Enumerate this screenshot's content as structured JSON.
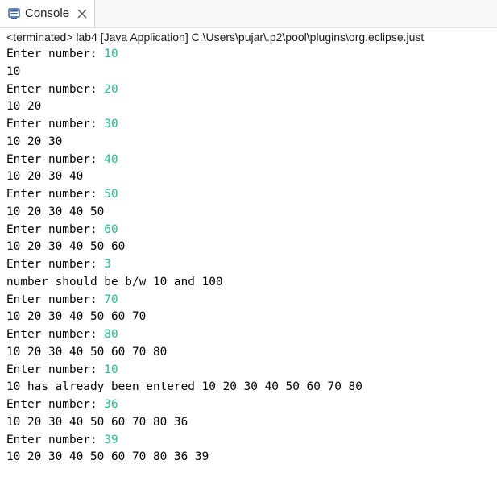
{
  "tab": {
    "label": "Console",
    "icon": "console-icon",
    "close_icon": "close-icon"
  },
  "status": {
    "text": "<terminated> lab4 [Java Application] C:\\Users\\pujar\\.p2\\pool\\plugins\\org.eclipse.just"
  },
  "colors": {
    "input": "#21c08b",
    "output": "#000000"
  },
  "output": {
    "lines": [
      {
        "text": "Enter number: ",
        "input": "10"
      },
      {
        "text": "10",
        "input": ""
      },
      {
        "text": "Enter number: ",
        "input": "20"
      },
      {
        "text": "10 20",
        "input": ""
      },
      {
        "text": "Enter number: ",
        "input": "30"
      },
      {
        "text": "10 20 30",
        "input": ""
      },
      {
        "text": "Enter number: ",
        "input": "40"
      },
      {
        "text": "10 20 30 40",
        "input": ""
      },
      {
        "text": "Enter number: ",
        "input": "50"
      },
      {
        "text": "10 20 30 40 50",
        "input": ""
      },
      {
        "text": "Enter number: ",
        "input": "60"
      },
      {
        "text": "10 20 30 40 50 60",
        "input": ""
      },
      {
        "text": "Enter number: ",
        "input": "3"
      },
      {
        "text": "number should be b/w 10 and 100",
        "input": ""
      },
      {
        "text": "Enter number: ",
        "input": "70"
      },
      {
        "text": "10 20 30 40 50 60 70",
        "input": ""
      },
      {
        "text": "Enter number: ",
        "input": "80"
      },
      {
        "text": "10 20 30 40 50 60 70 80",
        "input": ""
      },
      {
        "text": "Enter number: ",
        "input": "10"
      },
      {
        "text": "10 has already been entered 10 20 30 40 50 60 70 80",
        "input": ""
      },
      {
        "text": "Enter number: ",
        "input": "36"
      },
      {
        "text": "10 20 30 40 50 60 70 80 36",
        "input": ""
      },
      {
        "text": "Enter number: ",
        "input": "39"
      },
      {
        "text": "10 20 30 40 50 60 70 80 36 39",
        "input": ""
      }
    ]
  }
}
